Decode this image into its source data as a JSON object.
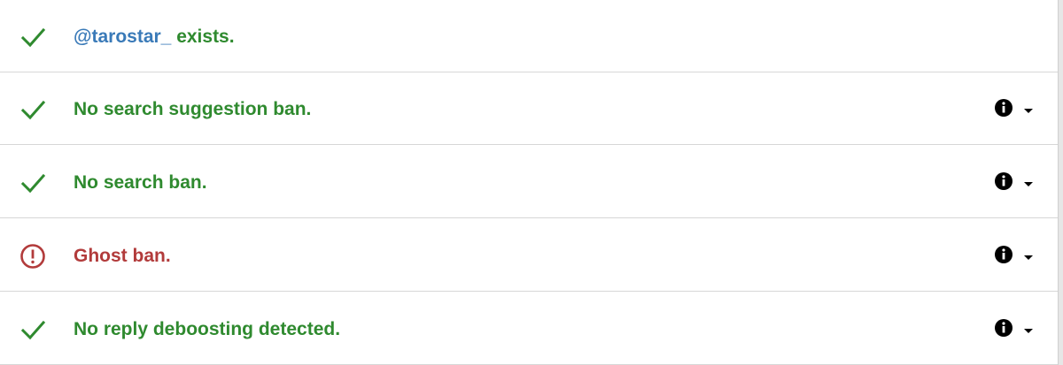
{
  "rows": [
    {
      "status": "ok",
      "icon": "check-icon",
      "handle": "@tarostar_",
      "text": " exists.",
      "has_actions": false
    },
    {
      "status": "ok",
      "icon": "check-icon",
      "text": "No search suggestion ban.",
      "has_actions": true
    },
    {
      "status": "ok",
      "icon": "check-icon",
      "text": "No search ban.",
      "has_actions": true
    },
    {
      "status": "bad",
      "icon": "alert-circle-icon",
      "text": "Ghost ban.",
      "has_actions": true
    },
    {
      "status": "ok",
      "icon": "check-icon",
      "text": "No reply deboosting detected.",
      "has_actions": true
    }
  ],
  "colors": {
    "ok": "#2f8a2f",
    "bad": "#b23b3b",
    "handle": "#3a7ab8",
    "divider": "#d7d7d7"
  },
  "icons": {
    "info": "info-icon",
    "expand": "chevron-down-icon"
  }
}
